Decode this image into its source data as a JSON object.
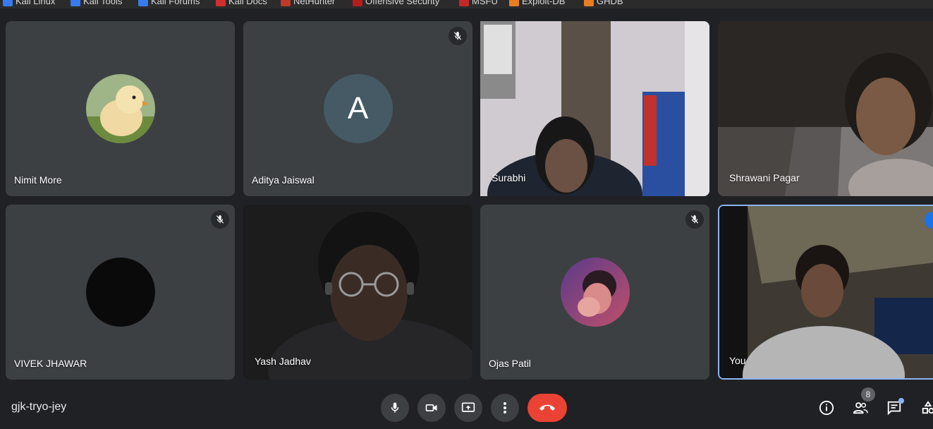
{
  "bookmarks": [
    "Kali Linux",
    "Kali Tools",
    "Kali Forums",
    "Kali Docs",
    "NetHunter",
    "Offensive Security",
    "MSFU",
    "Exploit-DB",
    "GHDB"
  ],
  "participants": [
    {
      "name": "Nimit More",
      "muted": false,
      "kind": "avatar-photo"
    },
    {
      "name": "Aditya Jaiswal",
      "muted": true,
      "kind": "avatar-letter",
      "letter": "A"
    },
    {
      "name": "Surabhi",
      "muted": false,
      "kind": "video"
    },
    {
      "name": "Shrawani Pagar",
      "muted": false,
      "kind": "video"
    },
    {
      "name": "VIVEK JHAWAR",
      "muted": true,
      "kind": "avatar-dark"
    },
    {
      "name": "Yash Jadhav",
      "muted": false,
      "kind": "video"
    },
    {
      "name": "Ojas Patil",
      "muted": true,
      "kind": "avatar-photo"
    },
    {
      "name": "You",
      "muted": false,
      "kind": "video"
    }
  ],
  "meeting": {
    "code": "gjk-tryo-jey"
  },
  "people_count": "8",
  "colors": {
    "accent": "#8ab4f8",
    "end_call": "#ea4335",
    "tile": "#3c4043",
    "background": "#202124",
    "letter_avatar": "#455a64"
  },
  "controls": [
    "microphone-icon",
    "camera-icon",
    "present-screen-icon",
    "more-options-icon",
    "end-call-icon"
  ],
  "side_controls": [
    "info-icon",
    "people-icon",
    "chat-icon",
    "activities-icon"
  ]
}
